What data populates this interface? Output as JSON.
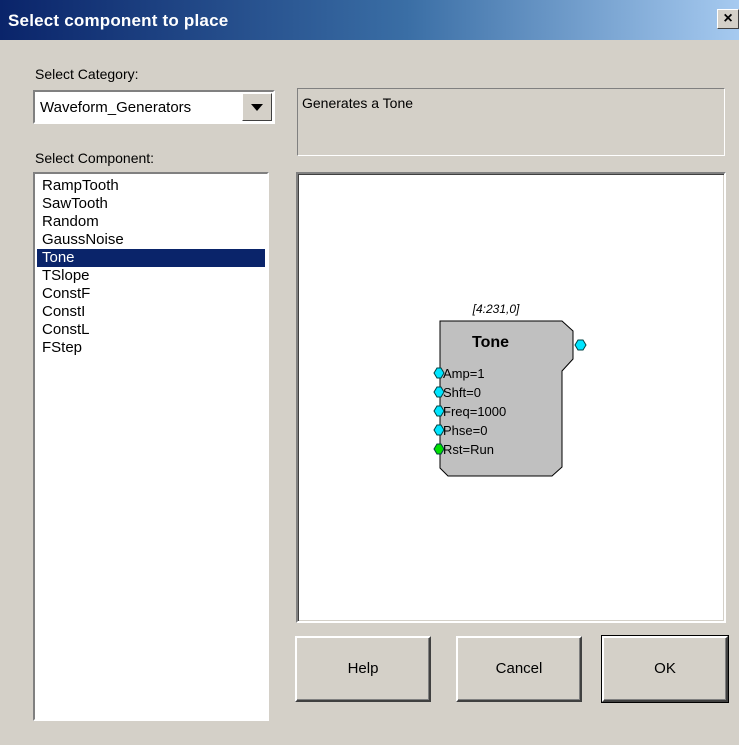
{
  "window": {
    "title": "Select component to place",
    "close_glyph": "×"
  },
  "category": {
    "label": "Select Category:",
    "selected": "Waveform_Generators"
  },
  "component": {
    "label": "Select Component:",
    "items": [
      "RampTooth",
      "SawTooth",
      "Random",
      "GaussNoise",
      "Tone",
      "TSlope",
      "ConstF",
      "ConstI",
      "ConstL",
      "FStep"
    ],
    "selected_index": 4
  },
  "description": "Generates a Tone",
  "preview": {
    "address": "[4:231,0]",
    "name": "Tone",
    "inputs": [
      {
        "label": "Amp=1",
        "color": "#00e5ff"
      },
      {
        "label": "Shft=0",
        "color": "#00e5ff"
      },
      {
        "label": "Freq=1000",
        "color": "#00e5ff"
      },
      {
        "label": "Phse=0",
        "color": "#00e5ff"
      },
      {
        "label": "Rst=Run",
        "color": "#00e000"
      }
    ],
    "output_color": "#00e5ff",
    "block_fill": "#c0c0c0"
  },
  "buttons": {
    "help": "Help",
    "cancel": "Cancel",
    "ok": "OK"
  }
}
